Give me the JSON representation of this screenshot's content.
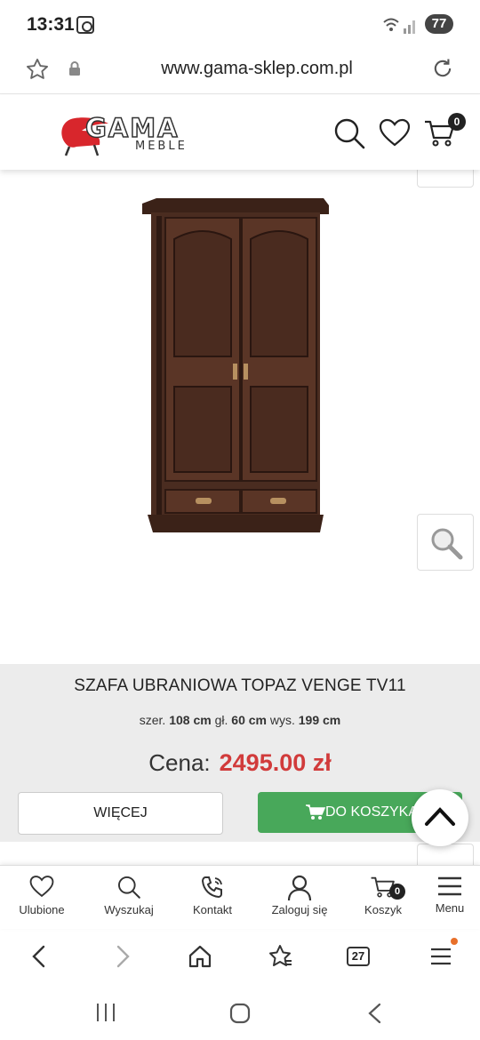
{
  "status_bar": {
    "time": "13:31",
    "battery": "77"
  },
  "browser": {
    "url": "www.gama-sklep.com.pl"
  },
  "site_header": {
    "logo_word": "GAMA",
    "logo_sub": "MEBLE",
    "cart_count": "0"
  },
  "product": {
    "title": "SZAFA UBRANIOWA TOPAZ VENGE TV11",
    "dims": {
      "w_label": "szer.",
      "w_value": "108 cm",
      "d_label": "gł.",
      "d_value": "60 cm",
      "h_label": "wys.",
      "h_value": "199 cm"
    },
    "price_label": "Cena:",
    "price": "2495.00 zł",
    "more_button": "WIĘCEJ",
    "cart_button": "DO KOSZYKA"
  },
  "bottom_nav": {
    "items": [
      {
        "label": "Ulubione",
        "icon": "heart-icon"
      },
      {
        "label": "Wyszukaj",
        "icon": "search-icon"
      },
      {
        "label": "Kontakt",
        "icon": "phone-icon"
      },
      {
        "label": "Zaloguj się",
        "icon": "user-icon"
      },
      {
        "label": "Koszyk",
        "icon": "cart-icon",
        "badge": "0"
      },
      {
        "label": "Menu",
        "icon": "hamburger-icon"
      }
    ]
  },
  "browser_toolbar": {
    "tabs_count": "27"
  },
  "colors": {
    "price": "#d13b3b",
    "cart_button": "#48a85a",
    "info_bg": "#ececec",
    "wood": "#3b2218"
  }
}
